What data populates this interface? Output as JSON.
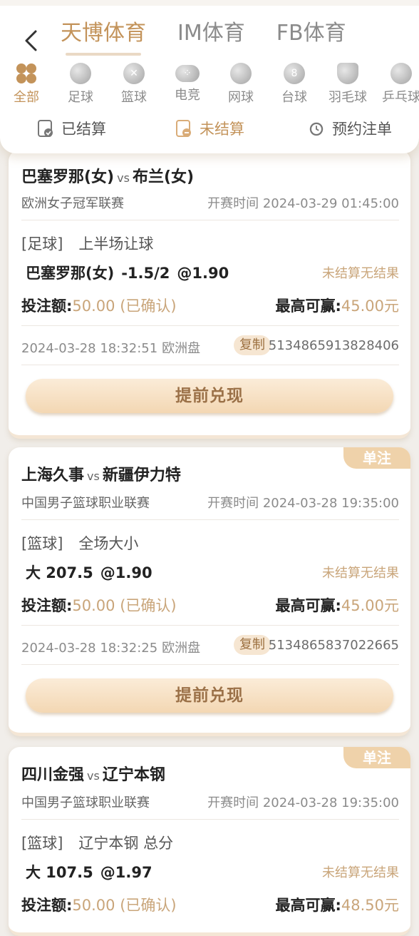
{
  "header": {
    "tabs": [
      "天博体育",
      "IM体育",
      "FB体育"
    ],
    "active_tab": 0
  },
  "sports": [
    {
      "label": "全部",
      "icon": "clover-icon"
    },
    {
      "label": "足球",
      "icon": "soccer-ball-icon"
    },
    {
      "label": "篮球",
      "icon": "basketball-icon"
    },
    {
      "label": "电竞",
      "icon": "gamepad-icon"
    },
    {
      "label": "网球",
      "icon": "tennis-ball-icon"
    },
    {
      "label": "台球",
      "icon": "billiard-ball-icon"
    },
    {
      "label": "羽毛球",
      "icon": "shuttlecock-icon"
    },
    {
      "label": "乒乓球",
      "icon": "ping-pong-icon"
    }
  ],
  "filters": [
    {
      "label": "已结算",
      "icon": "settled-icon"
    },
    {
      "label": "未结算",
      "icon": "unsettled-icon"
    },
    {
      "label": "预约注单",
      "icon": "clock-icon"
    }
  ],
  "labels": {
    "vs": "vs",
    "start_prefix": "开赛时间",
    "stake_label": "投注额:",
    "maxwin_label": "最高可赢:",
    "copy": "复制",
    "cashout": "提前兑现",
    "badge": "单注",
    "status": "未结算无结果"
  },
  "bets": [
    {
      "home": "巴塞罗那(女)",
      "away": "布兰(女)",
      "league": "欧洲女子冠军联赛",
      "start_time": "2024-03-29 01:45:00",
      "sport_tag": "[足球]",
      "market": "上半场让球",
      "pick": "巴塞罗那(女)",
      "line": "-1.5/2",
      "odds": "@1.90",
      "stake": "50.00 (已确认)",
      "max_win": "45.00元",
      "placed_time": "2024-03-28 18:32:51",
      "odds_type": "欧洲盘",
      "order_id": "5134865913828406"
    },
    {
      "home": "上海久事",
      "away": "新疆伊力特",
      "league": "中国男子篮球职业联赛",
      "start_time": "2024-03-28 19:35:00",
      "sport_tag": "[篮球]",
      "market": "全场大小",
      "pick": "大 207.5",
      "line": "",
      "odds": "@1.90",
      "stake": "50.00 (已确认)",
      "max_win": "45.00元",
      "placed_time": "2024-03-28 18:32:25",
      "odds_type": "欧洲盘",
      "order_id": "5134865837022665"
    },
    {
      "home": "四川金强",
      "away": "辽宁本钢",
      "league": "中国男子篮球职业联赛",
      "start_time": "2024-03-28 19:35:00",
      "sport_tag": "[篮球]",
      "market": "辽宁本钢 总分",
      "pick": "大 107.5",
      "line": "",
      "odds": "@1.97",
      "stake": "50.00 (已确认)",
      "max_win": "48.50元"
    }
  ]
}
